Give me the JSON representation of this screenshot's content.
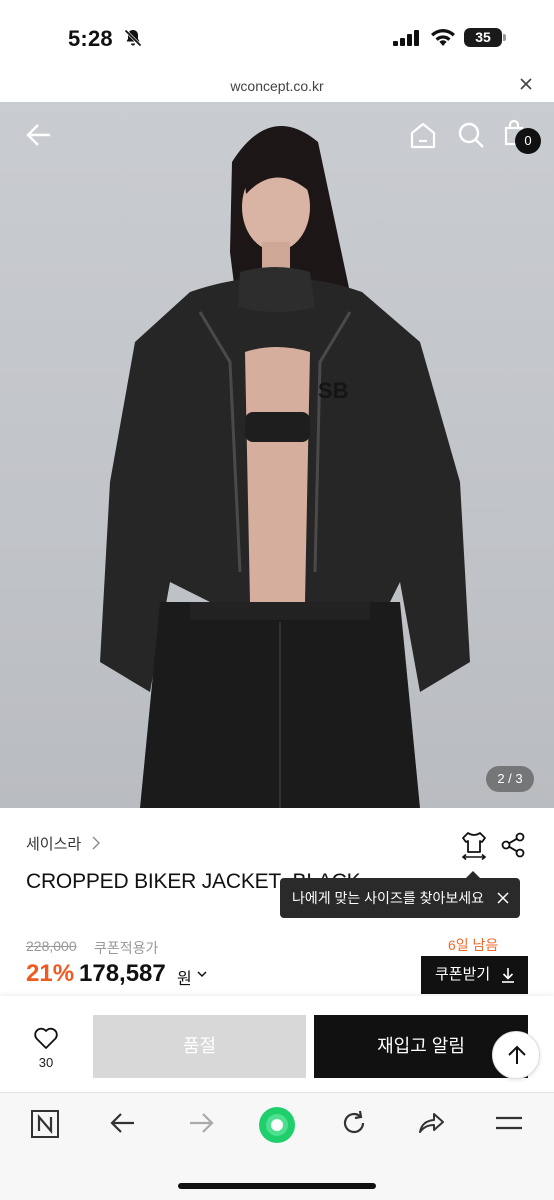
{
  "status_bar": {
    "time": "5:28",
    "battery": "35"
  },
  "browser": {
    "url": "wconcept.co.kr"
  },
  "header": {
    "cart_count": "0"
  },
  "gallery": {
    "indicator": "2 / 3"
  },
  "product": {
    "brand": "세이스라",
    "title": "CROPPED BIKER JACKET_BLACK",
    "tooltip": "나에게 맞는 사이즈를 찾아보세요",
    "original_price": "228,000",
    "coupon_label": "쿠폰적용가",
    "days_left": "6일 남음",
    "discount": "21%",
    "price": "178,587",
    "currency": "원",
    "coupon_button": "쿠폰받기"
  },
  "actions": {
    "like_count": "30",
    "soldout_label": "품절",
    "restock_label": "재입고 알림"
  },
  "colors": {
    "accent_orange": "#ef5a20",
    "dark": "#111111",
    "disabled": "#d8d8d8",
    "nav_green": "#1fcf6b"
  }
}
